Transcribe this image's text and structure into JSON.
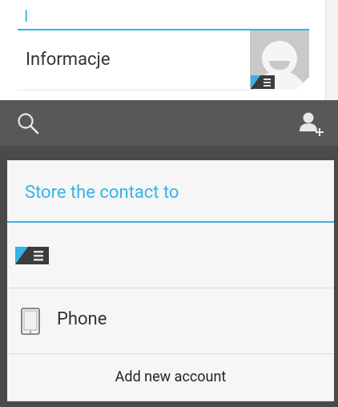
{
  "contact_list": {
    "section_letter": "I",
    "item_label": "Informacje"
  },
  "action_bar": {
    "search_icon": "search-icon",
    "add_contact_icon": "add-contact-icon"
  },
  "dialog": {
    "title": "Store the contact to",
    "options": [
      {
        "type": "sim",
        "icon": "sim-card-icon",
        "label": ""
      },
      {
        "type": "phone",
        "icon": "phone-icon",
        "label": "Phone"
      }
    ],
    "add_account_label": "Add new account"
  },
  "colors": {
    "accent": "#33b5e5",
    "action_bar": "#585858",
    "dialog_bg": "#f6f6f6"
  }
}
